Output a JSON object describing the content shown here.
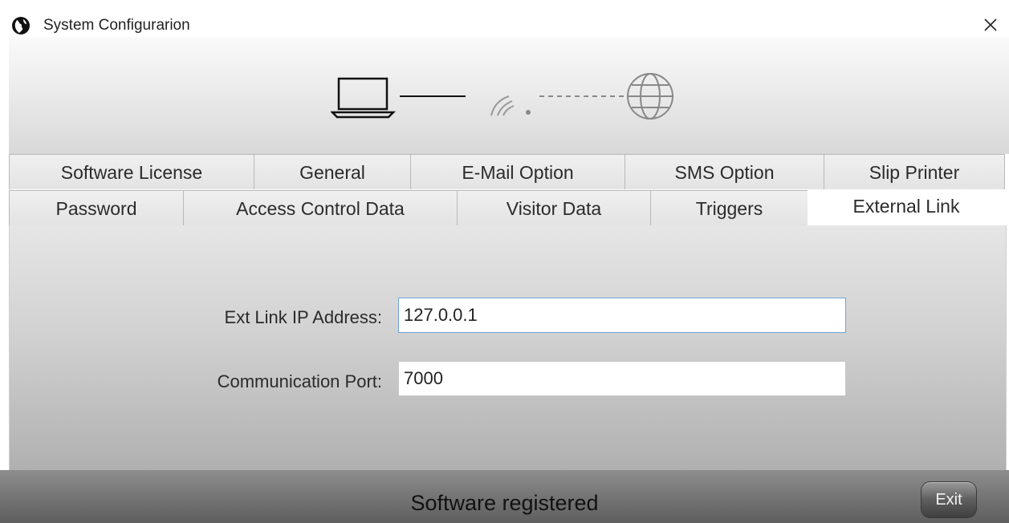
{
  "window": {
    "title": "System Configurarion",
    "close_symbol": "✕",
    "app_icon": "globe-logo-icon"
  },
  "hero": {
    "icons": [
      "laptop-icon",
      "wifi-signal-icon",
      "globe-icon"
    ]
  },
  "tabs": {
    "row1": [
      {
        "label": "Software License"
      },
      {
        "label": "General"
      },
      {
        "label": "E-Mail Option"
      },
      {
        "label": "SMS Option"
      },
      {
        "label": "Slip Printer"
      }
    ],
    "row2": [
      {
        "label": "Password"
      },
      {
        "label": "Access Control Data"
      },
      {
        "label": "Visitor Data"
      },
      {
        "label": "Triggers"
      },
      {
        "label": "External Link"
      }
    ],
    "active": "External Link"
  },
  "form": {
    "ip_label": "Ext Link IP Address:",
    "ip_value": "127.0.0.1",
    "port_label": "Communication Port:",
    "port_value": "7000"
  },
  "footer": {
    "status": "Software registered",
    "exit_label": "Exit"
  },
  "colors": {
    "input_focus_border": "#6fa3d8",
    "footer_bg": "#707070"
  }
}
